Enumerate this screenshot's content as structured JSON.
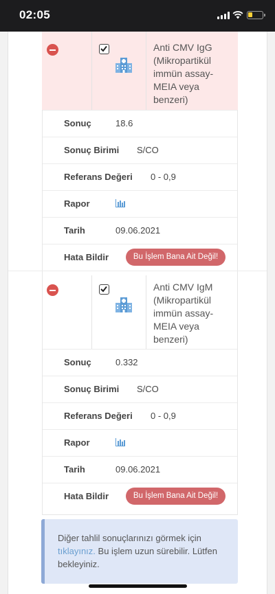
{
  "status_bar": {
    "time": "02:05"
  },
  "tests": [
    {
      "highlighted": true,
      "name_lines": [
        "Anti CMV IgG",
        "(Mikropartikül",
        "immün assay-",
        "MEIA veya",
        "benzeri)"
      ],
      "rows": {
        "result_label": "Sonuç",
        "result_value": "18.6",
        "unit_label": "Sonuç Birimi",
        "unit_value": "S/CO",
        "ref_label": "Referans Değeri",
        "ref_value": "0 - 0,9",
        "report_label": "Rapor",
        "date_label": "Tarih",
        "date_value": "09.06.2021",
        "error_label": "Hata Bildir",
        "error_button": "Bu İşlem Bana Ait Değil!"
      }
    },
    {
      "highlighted": false,
      "name_lines": [
        "Anti CMV IgM",
        "(Mikropartikül",
        "immün assay-",
        "MEIA veya",
        "benzeri)"
      ],
      "rows": {
        "result_label": "Sonuç",
        "result_value": "0.332",
        "unit_label": "Sonuç Birimi",
        "unit_value": "S/CO",
        "ref_label": "Referans Değeri",
        "ref_value": "0 - 0,9",
        "report_label": "Rapor",
        "date_label": "Tarih",
        "date_value": "09.06.2021",
        "error_label": "Hata Bildir",
        "error_button": "Bu İşlem Bana Ait Değil!"
      }
    }
  ],
  "info_box": {
    "text_before": "Diğer tahlil sonuçlarınızı görmek için",
    "link": "tıklayınız.",
    "text_after": "Bu işlem uzun sürebilir. Lütfen bekleyiniz."
  },
  "icons": {
    "remove": "remove-circle-icon",
    "checkbox": "checkbox-checked-icon",
    "building": "hospital-building-icon",
    "report": "bar-chart-icon"
  },
  "colors": {
    "remove_red": "#d9534f",
    "highlight_row": "#fde8e8",
    "error_button": "#d1676a",
    "info_bg": "#dfe7f7",
    "link": "#6a9fd0",
    "icon_blue": "#5b9bd5"
  }
}
